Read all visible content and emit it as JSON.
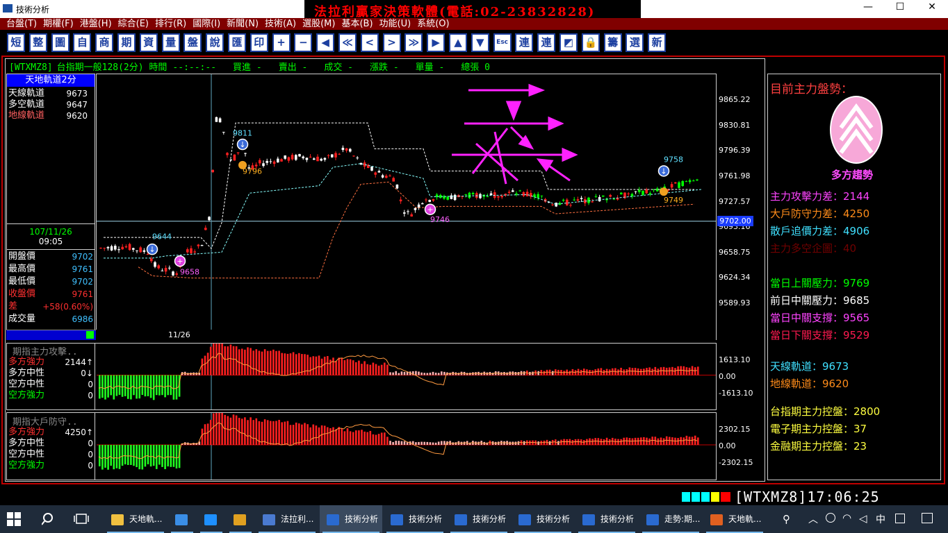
{
  "window": {
    "title": "技術分析",
    "minimize": "—",
    "maximize": "☐",
    "close": "✕"
  },
  "banner": "法拉利贏家決策軟體(電話:02-23832828)",
  "menu": [
    "台盤(T)",
    "期權(F)",
    "港盤(H)",
    "綜合(E)",
    "排行(R)",
    "國際(I)",
    "新聞(N)",
    "技術(A)",
    "選股(M)",
    "基本(B)",
    "功能(U)",
    "系統(O)"
  ],
  "toolbar": [
    "短",
    "整",
    "圖",
    "自",
    "商",
    "期",
    "資",
    "量",
    "盤",
    "說",
    "匯",
    "印",
    "+",
    "−",
    "◀",
    "≪",
    "<",
    ">",
    "≫",
    "▶",
    "▲",
    "▼",
    "Esc",
    "連",
    "連",
    "◩",
    "🔒",
    "籌",
    "選",
    "新"
  ],
  "headline": {
    "code": "[WTXMZ8]",
    "name": "台指期一般128(2分) 時間",
    "time": "--:--:--",
    "buy": "買進 -",
    "sell": "賣出 -",
    "deal": "成交 -",
    "change": "漲跌 -",
    "vol": "單量 -",
    "total": "總張 0"
  },
  "info": {
    "title": "天地軌道2分",
    "tracks": [
      {
        "label": "天線軌道",
        "value": "9673",
        "color": "#ffffff"
      },
      {
        "label": "多空軌道",
        "value": "9647",
        "color": "#ffffff"
      },
      {
        "label": "地線軌道",
        "value": "9620",
        "color": "#ff6060"
      }
    ],
    "date": "107/11/26",
    "time": "09:05",
    "quotes": [
      {
        "label": "開盤價",
        "value": "9702",
        "lc": "#ffffff",
        "vc": "#40c0ff"
      },
      {
        "label": "最高價",
        "value": "9761",
        "lc": "#ffffff",
        "vc": "#40c0ff"
      },
      {
        "label": "最低價",
        "value": "9702",
        "lc": "#ffffff",
        "vc": "#40c0ff"
      },
      {
        "label": "收盤價",
        "value": "9761",
        "lc": "#ff3030",
        "vc": "#ff3030"
      },
      {
        "label": "差",
        "value": "+58(0.60%)",
        "lc": "#ff3030",
        "vc": "#ff3030"
      },
      {
        "label": "成交量",
        "value": "6986",
        "lc": "#ffffff",
        "vc": "#40c0ff"
      }
    ]
  },
  "chart": {
    "axis_labels": [
      "9865.22",
      "9830.81",
      "9796.39",
      "9761.98",
      "9727.57",
      "9693.16",
      "9658.75",
      "9624.34",
      "9589.93"
    ],
    "current_price": "9702.00",
    "date_label": "11/26",
    "annotations": [
      "9811",
      "9796",
      "9644",
      "9658",
      "9746",
      "9758",
      "9749"
    ]
  },
  "chart_data": {
    "type": "candlestick",
    "ylim": [
      9589.93,
      9865.22
    ],
    "price_line": 9702,
    "levels": {
      "upper_track": 9673,
      "mid_track": 9647,
      "lower_track": 9620
    },
    "markers": [
      {
        "label": "9811",
        "kind": "sell"
      },
      {
        "label": "9796",
        "kind": "point"
      },
      {
        "label": "9644",
        "kind": "sell"
      },
      {
        "label": "9658",
        "kind": "buy"
      },
      {
        "label": "9746",
        "kind": "buy"
      },
      {
        "label": "9758",
        "kind": "sell"
      },
      {
        "label": "9749",
        "kind": "point"
      }
    ]
  },
  "sub1": {
    "title": "期指主力攻擊..",
    "rows": [
      {
        "label": "多方強力",
        "value": "2144↑",
        "lc": "#ff3030"
      },
      {
        "label": "多方中性",
        "value": "0↓",
        "lc": "#ffffff"
      },
      {
        "label": "空方中性",
        "value": "0",
        "lc": "#ffffff"
      },
      {
        "label": "空方強力",
        "value": "0",
        "lc": "#00ff00"
      }
    ],
    "axis": [
      "1613.10",
      "0.00",
      "-1613.10"
    ]
  },
  "sub2": {
    "title": "期指大戶防守..",
    "rows": [
      {
        "label": "多方強力",
        "value": "4250↑",
        "lc": "#ff3030"
      },
      {
        "label": "多方中性",
        "value": "0",
        "lc": "#ffffff"
      },
      {
        "label": "空方中性",
        "value": "0",
        "lc": "#ffffff"
      },
      {
        "label": "空方強力",
        "value": "0",
        "lc": "#00ff00"
      }
    ],
    "axis": [
      "2302.15",
      "0.00",
      "-2302.15"
    ]
  },
  "right": {
    "heading": "目前主力盤勢：",
    "trend": "多方趨勢",
    "stats": [
      {
        "text": "主力攻擊力差：2144",
        "color": "#ff44ff"
      },
      {
        "text": "大戶防守力差：4250",
        "color": "#ff8c1a"
      },
      {
        "text": "散戶追價力差：4906",
        "color": "#40e0ff"
      },
      {
        "text": "主力多空企圖：40",
        "color": "#700000"
      },
      {
        "text": "當日上關壓力：9769",
        "color": "#00ff00"
      },
      {
        "text": "前日中關壓力：9685",
        "color": "#ffffff"
      },
      {
        "text": "當日中關支撐：9565",
        "color": "#ff44ff"
      },
      {
        "text": "當日下關支撐：9529",
        "color": "#ff1a50"
      },
      {
        "text": "天線軌道：9673",
        "color": "#40e0ff"
      },
      {
        "text": "地線軌道：9620",
        "color": "#ff8c1a"
      },
      {
        "text": "台指期主力控盤：2800",
        "color": "#ffff40"
      },
      {
        "text": "電子期主力控盤：37",
        "color": "#ffff40"
      },
      {
        "text": "金融期主力控盤：23",
        "color": "#ffff40"
      }
    ]
  },
  "status": {
    "ticker": "[WTXMZ8]17:06:25"
  },
  "taskbar": {
    "items": [
      {
        "label": "天地軌...",
        "color": "#f0c040"
      },
      {
        "label": "",
        "color": "#3a8ee6"
      },
      {
        "label": "",
        "color": "#1e90ff"
      },
      {
        "label": "",
        "color": "#e0a020"
      },
      {
        "label": "法拉利...",
        "color": "#4a7ad0"
      },
      {
        "label": "技術分析",
        "color": "#2a6ad0"
      },
      {
        "label": "技術分析",
        "color": "#2a6ad0"
      },
      {
        "label": "技術分析",
        "color": "#2a6ad0"
      },
      {
        "label": "技術分析",
        "color": "#2a6ad0"
      },
      {
        "label": "技術分析",
        "color": "#2a6ad0"
      },
      {
        "label": "走勢:期...",
        "color": "#2a6ad0"
      },
      {
        "label": "天地軌...",
        "color": "#e06020"
      }
    ],
    "tray_lang": "中"
  }
}
